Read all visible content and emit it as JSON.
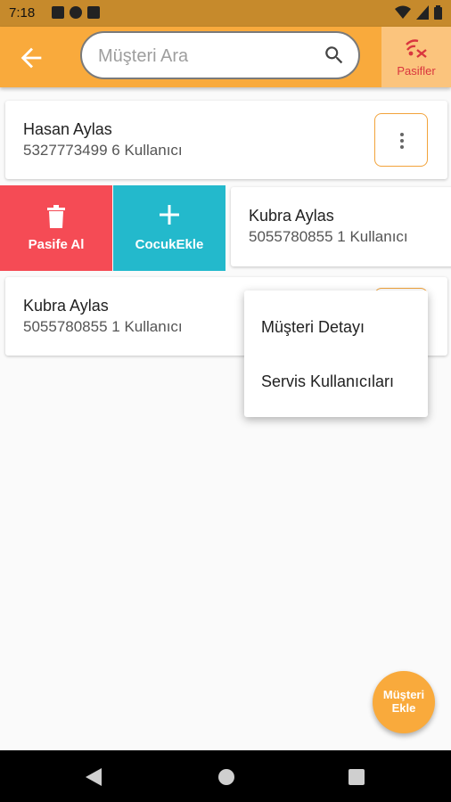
{
  "status_bar": {
    "time": "7:18"
  },
  "app_bar": {
    "search_placeholder": "Müşteri Ara",
    "pasifler_label": "Pasifler"
  },
  "customers": [
    {
      "name": "Hasan Aylas",
      "info": "5327773499 6 Kullanıcı"
    },
    {
      "name": "Kubra Aylas",
      "info": "5055780855 1 Kullanıcı"
    },
    {
      "name": "Kubra Aylas",
      "info": "5055780855 1 Kullanıcı"
    }
  ],
  "swipe_actions": {
    "deactivate_label": "Pasife Al",
    "add_child_label": "CocukEkle"
  },
  "popup_menu": {
    "items": [
      "Müşteri Detayı",
      "Servis Kullanıcıları"
    ]
  },
  "fab": {
    "line1": "Müşteri",
    "line2": "Ekle"
  },
  "colors": {
    "primary": "#f9aa3c",
    "status_bar": "#c68a2c",
    "danger": "#f54b55",
    "accent_teal": "#23b9cc",
    "pasifler_text": "#d9363e"
  },
  "icons": {
    "back": "arrow-left-icon",
    "search": "search-icon",
    "pasifler": "signal-off-icon",
    "more": "more-vert-icon",
    "delete": "trash-icon",
    "add": "plus-icon"
  }
}
